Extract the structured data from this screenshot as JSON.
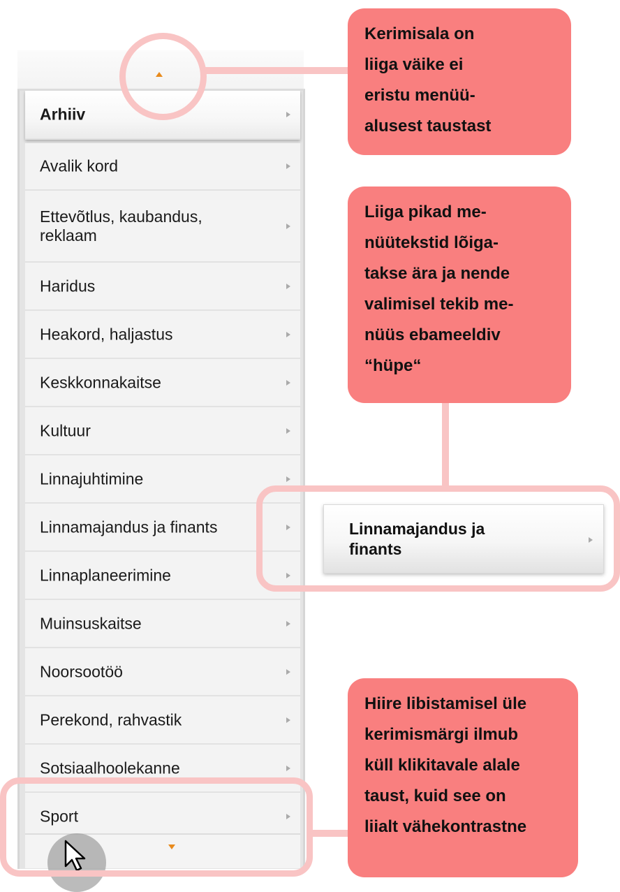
{
  "menu": {
    "items": [
      {
        "label": "Arhiiv",
        "active": true
      },
      {
        "label": "Avalik kord"
      },
      {
        "label": "Ettevõtlus, kaubandus,\nreklaam"
      },
      {
        "label": "Haridus"
      },
      {
        "label": "Heakord, haljastus"
      },
      {
        "label": "Keskkonnakaitse"
      },
      {
        "label": "Kultuur"
      },
      {
        "label": "Linnajuhtimine"
      },
      {
        "label": "Linnamajandus ja finants"
      },
      {
        "label": "Linnaplaneerimine"
      },
      {
        "label": "Muinsuskaitse"
      },
      {
        "label": "Noorsootöö"
      },
      {
        "label": "Perekond, rahvastik"
      },
      {
        "label": "Sotsiaalhoolekanne"
      },
      {
        "label": "Sport"
      }
    ]
  },
  "popup": {
    "label": "Linnamajandus ja\nfinants"
  },
  "callouts": {
    "scroll_area": "Kerimisala on\nliiga väike ei\neristu menüü-\nalusest taustast",
    "long_texts": "Liiga pikad me-\nnüütekstid lõiga-\ntakse ära ja nende\nvalimisel tekib me-\nnüüs ebameeldiv\n“hüpe“",
    "hover": "Hiire libistamisel üle\nkerimismärgi ilmub\nküll klikitavale alale\ntaust, kuid see on\nliialt vähekontrastne"
  },
  "colors": {
    "callout": "#f97f7f",
    "highlight": "#f9c4c4",
    "scroll_arrow": "#e88a1c"
  },
  "icons": {
    "scroll_up": "triangle-up-icon",
    "scroll_down": "triangle-down-icon",
    "submenu": "chevron-right-icon",
    "cursor": "mouse-pointer-icon"
  }
}
